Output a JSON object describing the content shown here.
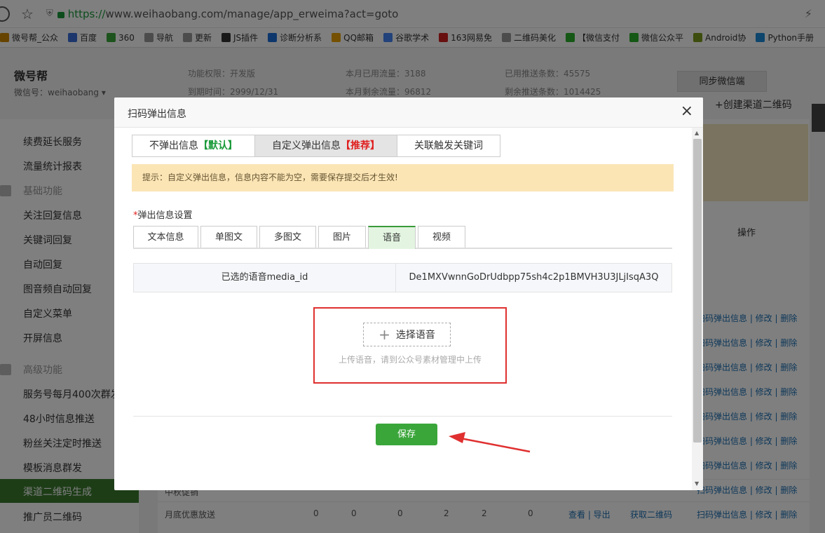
{
  "browser": {
    "url_scheme": "https://",
    "url_rest": "www.weihaobang.com/manage/app_erweima?act=goto",
    "bookmarks": [
      {
        "label": "微号帮_公众",
        "icon": "globe-icon",
        "color": "#cc8800"
      },
      {
        "label": "百度",
        "icon": "baidu-icon",
        "color": "#3a6fd8"
      },
      {
        "label": "360",
        "icon": "360-icon",
        "color": "#3aa63a"
      },
      {
        "label": "导航",
        "icon": "page-icon",
        "color": "#999999"
      },
      {
        "label": "更新",
        "icon": "page-icon",
        "color": "#999999"
      },
      {
        "label": "JS插件",
        "icon": "js-icon",
        "color": "#333333"
      },
      {
        "label": "诊断分析系",
        "icon": "z-icon",
        "color": "#1a6fd8"
      },
      {
        "label": "QQ邮箱",
        "icon": "chrome-icon",
        "color": "#e8a000"
      },
      {
        "label": "谷歌学术",
        "icon": "google-icon",
        "color": "#4285f4"
      },
      {
        "label": "163网易免",
        "icon": "163-icon",
        "color": "#d02020"
      },
      {
        "label": "二维码美化",
        "icon": "page-icon",
        "color": "#999999"
      },
      {
        "label": "【微信支付",
        "icon": "wechat-icon",
        "color": "#2aae2a"
      },
      {
        "label": "微信公众平",
        "icon": "wechat-icon",
        "color": "#2aae2a"
      },
      {
        "label": "Android协",
        "icon": "android-icon",
        "color": "#7a9a1a"
      },
      {
        "label": "Python手册",
        "icon": "python-icon",
        "color": "#1a8ad8"
      }
    ]
  },
  "header": {
    "brand": "微号帮",
    "wechat_id": "微信号：weihaobang ▾",
    "stats": [
      {
        "text": "功能权限：开发版"
      },
      {
        "text": "本月已用流量：3188"
      },
      {
        "text": "已用推送条数：45575"
      },
      {
        "text": "到期时间：2999/12/31"
      },
      {
        "text": "本月剩余流量：96812"
      },
      {
        "text": "剩余推送条数：1014425"
      }
    ],
    "sync_button": "同步微信端"
  },
  "sidebar": {
    "items": [
      {
        "label": "续费延长服务",
        "type": "item"
      },
      {
        "label": "流量统计报表",
        "type": "item"
      },
      {
        "label": "基础功能",
        "type": "section"
      },
      {
        "label": "关注回复信息",
        "type": "item"
      },
      {
        "label": "关键词回复",
        "type": "item"
      },
      {
        "label": "自动回复",
        "type": "item"
      },
      {
        "label": "图音频自动回复",
        "type": "item"
      },
      {
        "label": "自定义菜单",
        "type": "item"
      },
      {
        "label": "开屏信息",
        "type": "item"
      },
      {
        "label": "高级功能",
        "type": "section"
      },
      {
        "label": "服务号每月400次群发",
        "type": "item"
      },
      {
        "label": "48小时信息推送",
        "type": "item"
      },
      {
        "label": "粉丝关注定时推送",
        "type": "item"
      },
      {
        "label": "模板消息群发",
        "type": "item"
      },
      {
        "label": "渠道二维码生成",
        "type": "active"
      },
      {
        "label": "推广员二维码",
        "type": "item"
      }
    ]
  },
  "main": {
    "create_link": "+创建渠道二维码",
    "ops_header": "操作",
    "op_row_text": "扫码弹出信息 | 修改 | 删除",
    "last_row": {
      "partial_name": "中秋促销",
      "name": "月底优惠放送",
      "nums": [
        "0",
        "0",
        "0",
        "2",
        "2",
        "0"
      ],
      "view": "查看 | 导出",
      "get": "获取二维码",
      "ops": "扫码弹出信息 | 修改 | 删除"
    }
  },
  "modal": {
    "title": "扫码弹出信息",
    "close": "×",
    "tabs": [
      {
        "text": "不弹出信息",
        "tag": "【默认】"
      },
      {
        "text": "自定义弹出信息",
        "tag": "【推荐】"
      },
      {
        "text": "关联触发关键词",
        "tag": ""
      }
    ],
    "tip": "提示：自定义弹出信息，信息内容不能为空，需要保存提交后才生效!",
    "section_required": "*",
    "section_title": "弹出信息设置",
    "subtabs": [
      "文本信息",
      "单图文",
      "多图文",
      "图片",
      "语音",
      "视频"
    ],
    "selected_subtab": "语音",
    "media_label": "已选的语音media_id",
    "media_value": "De1MXVwnnGoDrUdbpp75sh4c2p1BMVH3U3JLjIsqA3Q",
    "pick_button": "选择语音",
    "pick_hint": "上传语音，请到公众号素材管理中上传",
    "save_button": "保存",
    "annotation_color": "#e03030"
  }
}
